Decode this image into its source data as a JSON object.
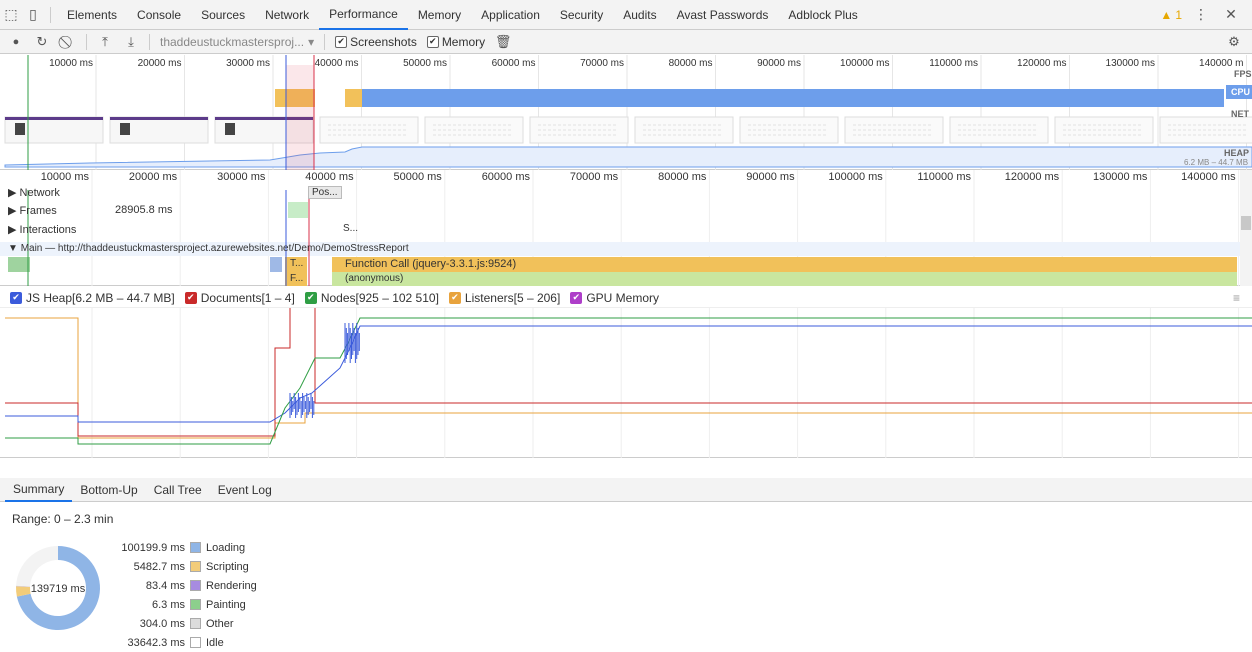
{
  "tabs": [
    {
      "label": "Elements"
    },
    {
      "label": "Console"
    },
    {
      "label": "Sources"
    },
    {
      "label": "Network"
    },
    {
      "label": "Performance"
    },
    {
      "label": "Memory"
    },
    {
      "label": "Application"
    },
    {
      "label": "Security"
    },
    {
      "label": "Audits"
    },
    {
      "label": "Avast Passwords"
    },
    {
      "label": "Adblock Plus"
    }
  ],
  "active_tab": "Performance",
  "warnings": "1",
  "toolbar": {
    "profile_select": "thaddeustuckmastersproj...",
    "screenshots_label": "Screenshots",
    "memory_label": "Memory"
  },
  "overview": {
    "ticks": [
      "10000 ms",
      "20000 ms",
      "30000 ms",
      "40000 ms",
      "50000 ms",
      "60000 ms",
      "70000 ms",
      "80000 ms",
      "90000 ms",
      "100000 ms",
      "110000 ms",
      "120000 ms",
      "130000 ms",
      "140000 m"
    ],
    "labels": {
      "fps": "FPS",
      "cpu": "CPU",
      "net": "NET",
      "heap": "HEAP",
      "heap_range": "6.2 MB – 44.7 MB"
    }
  },
  "flame": {
    "ticks": [
      "10000 ms",
      "20000 ms",
      "30000 ms",
      "40000 ms",
      "50000 ms",
      "60000 ms",
      "70000 ms",
      "80000 ms",
      "90000 ms",
      "100000 ms",
      "110000 ms",
      "120000 ms",
      "130000 ms",
      "140000 ms"
    ],
    "network_label": "Network",
    "network_item": "Pos...",
    "frames_label": "Frames",
    "frames_value": "28905.8 ms",
    "interactions_label": "Interactions",
    "interactions_item": "S...",
    "main_label": "Main — http://thaddeustuckmastersproject.azurewebsites.net/Demo/DemoStressReport",
    "function_call": "Function Call (jquery-3.3.1.js:9524)",
    "anonymous": "(anonymous)",
    "t_label": "T...",
    "f_label": "F..."
  },
  "counters": [
    {
      "label": "JS Heap[6.2 MB – 44.7 MB]",
      "color": "#3b5bdb"
    },
    {
      "label": "Documents[1 – 4]",
      "color": "#c92a2a"
    },
    {
      "label": "Nodes[925 – 102 510]",
      "color": "#2f9e44"
    },
    {
      "label": "Listeners[5 – 206]",
      "color": "#e8a33d"
    },
    {
      "label": "GPU Memory",
      "color": "#ae3ec9"
    }
  ],
  "bottom_tabs": [
    "Summary",
    "Bottom-Up",
    "Call Tree",
    "Event Log"
  ],
  "summary": {
    "range": "Range: 0 – 2.3 min",
    "total": "139719 ms",
    "items": [
      {
        "value": "100199.9 ms",
        "label": "Loading",
        "color": "#8fb5e6"
      },
      {
        "value": "5482.7 ms",
        "label": "Scripting",
        "color": "#f2cc7a"
      },
      {
        "value": "83.4 ms",
        "label": "Rendering",
        "color": "#a78be0"
      },
      {
        "value": "6.3 ms",
        "label": "Painting",
        "color": "#8ccf8c"
      },
      {
        "value": "304.0 ms",
        "label": "Other",
        "color": "#dcdcdc"
      },
      {
        "value": "33642.3 ms",
        "label": "Idle",
        "color": "#ffffff"
      }
    ]
  }
}
